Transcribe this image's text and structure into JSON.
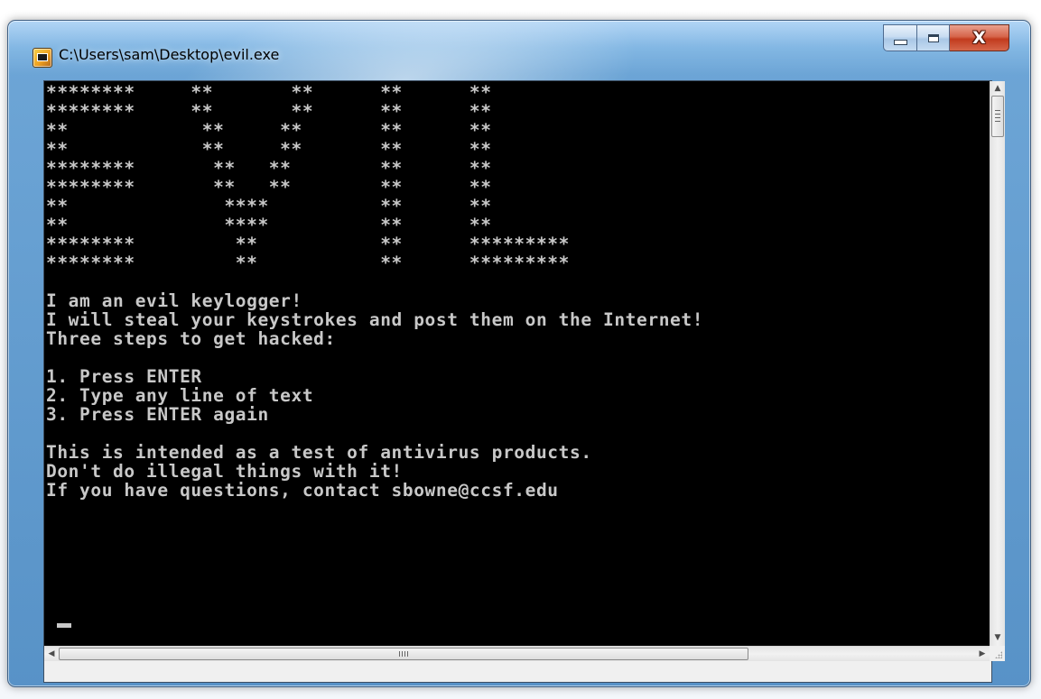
{
  "window": {
    "title": "C:\\Users\\sam\\Desktop\\evil.exe",
    "app_icon": "console-app-icon",
    "caption_buttons": {
      "minimize_icon": "minimize-icon",
      "maximize_icon": "maximize-icon",
      "close_glyph": "X"
    }
  },
  "console": {
    "lines": [
      "********     **       **      **      **",
      "********     **       **      **      **",
      "**            **     **       **      **",
      "**            **     **       **      **",
      "********       **   **        **      **",
      "********       **   **        **      **",
      "**              ****          **      **",
      "**              ****          **      **",
      "********         **           **      *********",
      "********         **           **      *********",
      "",
      "I am an evil keylogger!",
      "I will steal your keystrokes and post them on the Internet!",
      "Three steps to get hacked:",
      "",
      "1. Press ENTER",
      "2. Type any line of text",
      "3. Press ENTER again",
      "",
      "This is intended as a test of antivirus products.",
      "Don't do illegal things with it!",
      "If you have questions, contact sbowne@ccsf.edu"
    ],
    "text_color": "#c8c8c8",
    "background_color": "#000000"
  },
  "scrollbars": {
    "vertical": {
      "up_glyph": "▲",
      "down_glyph": "▼"
    },
    "horizontal": {
      "left_glyph": "◀",
      "right_glyph": "▶",
      "thumb_grip": "III"
    }
  }
}
